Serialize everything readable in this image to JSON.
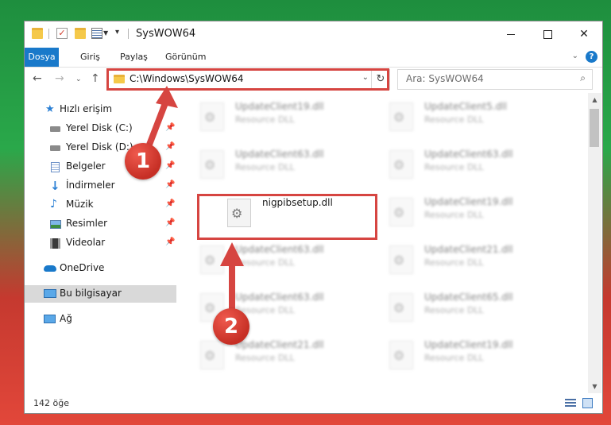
{
  "window": {
    "title": "SysWOW64",
    "minimize_glyph": "",
    "close_glyph": "✕"
  },
  "ribbon": {
    "tabs": [
      "Dosya",
      "Giriş",
      "Paylaş",
      "Görünüm"
    ],
    "help_glyph": "?"
  },
  "navigation": {
    "address": "C:\\Windows\\SysWOW64",
    "search_placeholder": "Ara: SysWOW64"
  },
  "sidebar": {
    "items": [
      {
        "label": "Hızlı erişim",
        "icon": "star-icon"
      },
      {
        "label": "Yerel Disk (C:)",
        "icon": "drive-icon",
        "pinned": true
      },
      {
        "label": "Yerel Disk (D:)",
        "icon": "drive-icon",
        "pinned": true
      },
      {
        "label": "Belgeler",
        "icon": "document-icon",
        "pinned": true
      },
      {
        "label": "İndirmeler",
        "icon": "download-icon",
        "pinned": true
      },
      {
        "label": "Müzik",
        "icon": "music-icon",
        "pinned": true
      },
      {
        "label": "Resimler",
        "icon": "picture-icon",
        "pinned": true
      },
      {
        "label": "Videolar",
        "icon": "video-icon",
        "pinned": true
      },
      {
        "label": "OneDrive",
        "icon": "cloud-icon"
      },
      {
        "label": "Bu bilgisayar",
        "icon": "computer-icon",
        "selected": true
      },
      {
        "label": "Ağ",
        "icon": "network-icon"
      }
    ]
  },
  "files": {
    "left_column": [
      {
        "name": "UpdateClient19.dll",
        "type": "Resource DLL"
      },
      {
        "name": "UpdateClient63.dll",
        "type": "Resource DLL"
      },
      {
        "name": "nigpibsetup.dll",
        "type": ""
      },
      {
        "name": "UpdateClient63.dll",
        "type": "Resource DLL"
      },
      {
        "name": "UpdateClient63.dll",
        "type": "Resource DLL"
      },
      {
        "name": "UpdateClient21.dll",
        "type": "Resource DLL"
      }
    ],
    "right_column": [
      {
        "name": "UpdateClient5.dll",
        "type": "Resource DLL"
      },
      {
        "name": "UpdateClient63.dll",
        "type": "Resource DLL"
      },
      {
        "name": "UpdateClient19.dll",
        "type": "Resource DLL"
      },
      {
        "name": "UpdateClient21.dll",
        "type": "Resource DLL"
      },
      {
        "name": "UpdateClient65.dll",
        "type": "Resource DLL"
      },
      {
        "name": "UpdateClient19.dll",
        "type": "Resource DLL"
      }
    ]
  },
  "status": {
    "item_count": "142 öğe"
  },
  "annotations": {
    "callout_1": "1",
    "callout_2": "2",
    "color": "#d64541"
  }
}
